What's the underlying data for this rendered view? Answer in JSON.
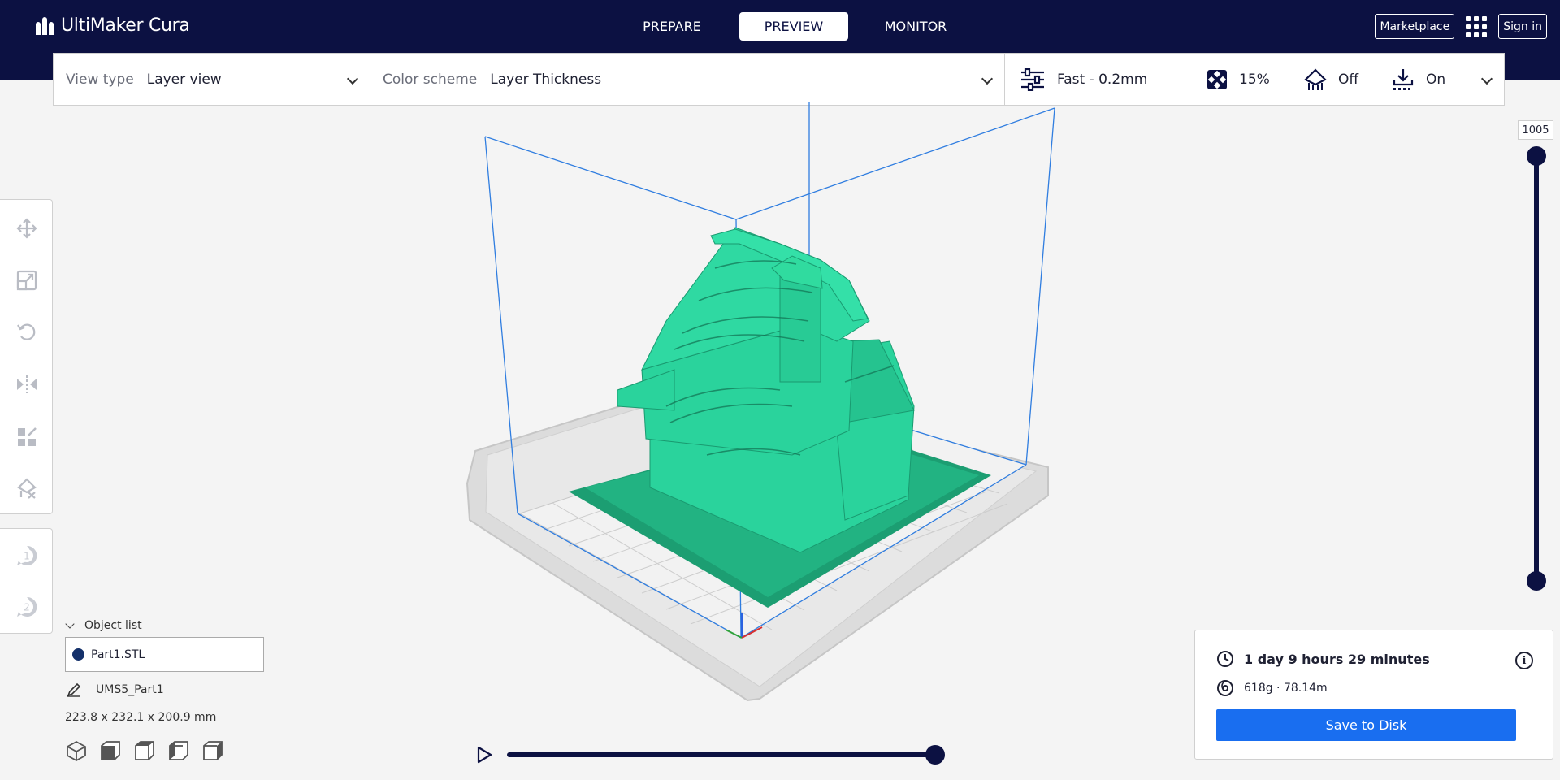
{
  "app": {
    "brand": "UltiMaker Cura"
  },
  "stages": [
    {
      "label": "PREPARE",
      "active": false
    },
    {
      "label": "PREVIEW",
      "active": true
    },
    {
      "label": "MONITOR",
      "active": false
    }
  ],
  "header": {
    "marketplace": "Marketplace",
    "signin": "Sign in"
  },
  "toolbar": {
    "view_type_label": "View type",
    "view_type_value": "Layer view",
    "color_scheme_label": "Color scheme",
    "color_scheme_value": "Layer Thickness",
    "profile": "Fast - 0.2mm",
    "infill": "15%",
    "support": "Off",
    "adhesion": "On"
  },
  "tools": [
    "move-icon",
    "scale-icon",
    "rotate-icon",
    "mirror-icon",
    "per-model-settings-icon",
    "support-blocker-icon"
  ],
  "extruders": [
    "1",
    "2"
  ],
  "layer_slider": {
    "max_layer": "1005"
  },
  "objects": {
    "header": "Object list",
    "items": [
      {
        "name": "Part1.STL",
        "color": "#14306a"
      }
    ],
    "job_name": "UMS5_Part1",
    "dimensions": "223.8 x 232.1 x 200.9 mm"
  },
  "camera_views": [
    "3d-view-icon",
    "front-view-icon",
    "top-view-icon",
    "left-view-icon",
    "right-view-icon"
  ],
  "print_info": {
    "time": "1 day 9 hours 29 minutes",
    "material": "618g · 78.14m",
    "save_label": "Save to Disk"
  },
  "colors": {
    "header_bg": "#0c1142",
    "accent": "#196ef0",
    "model": "#2ad39c"
  }
}
